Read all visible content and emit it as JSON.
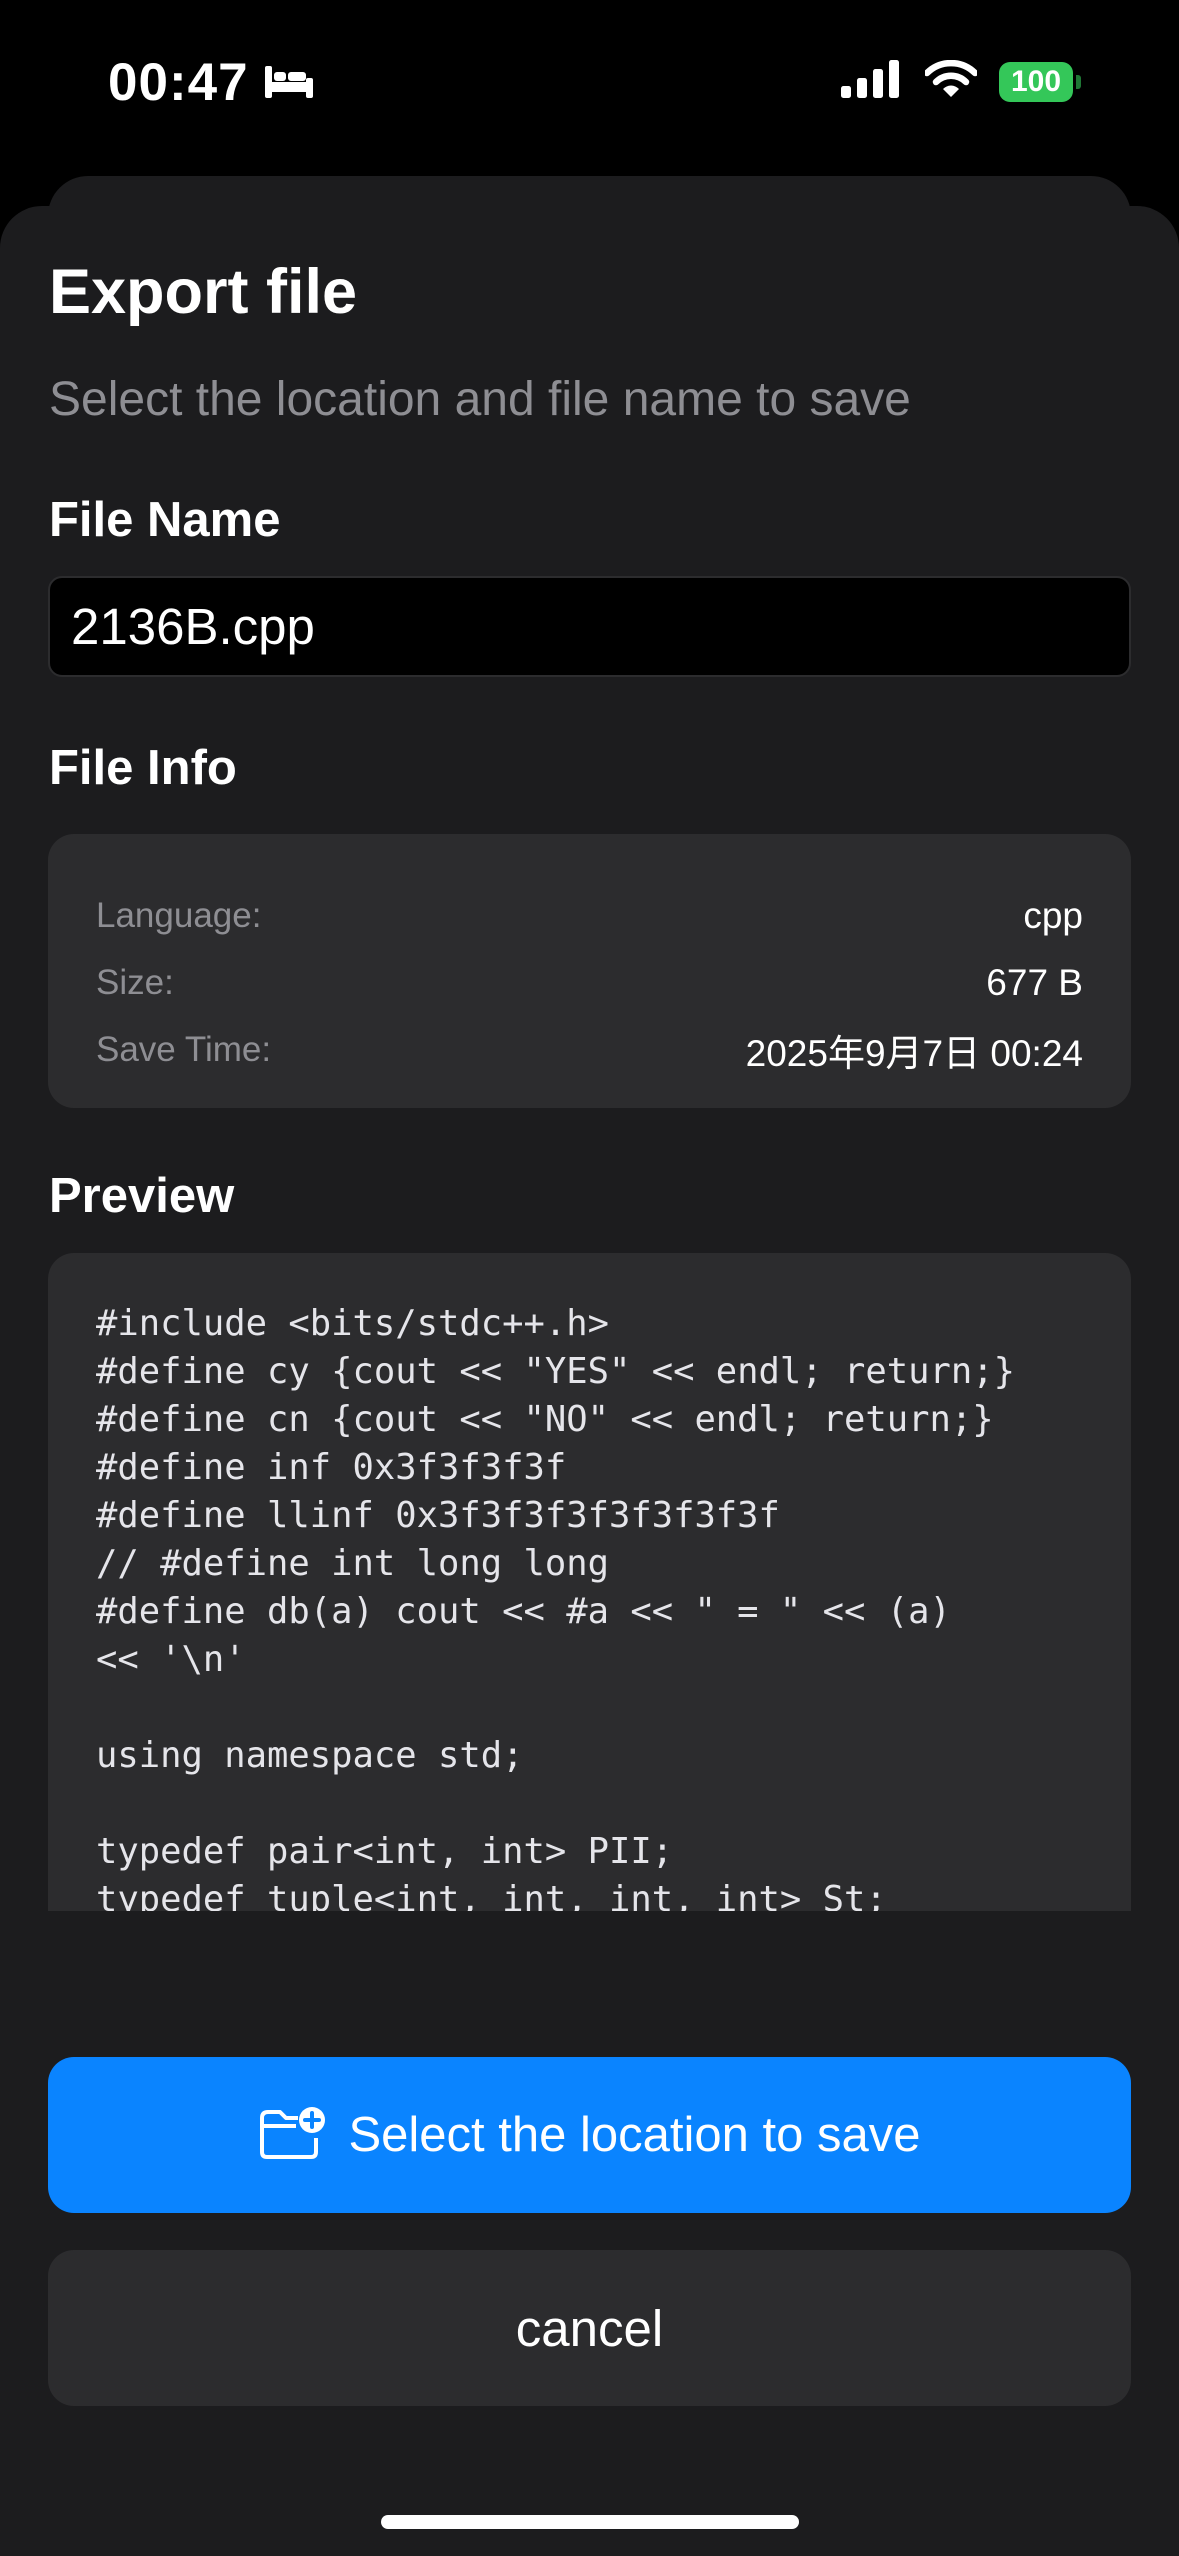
{
  "status_bar": {
    "time": "00:47",
    "focus_icon": "bed-icon",
    "battery": "100"
  },
  "sheet": {
    "title": "Export file",
    "subtitle": "Select the location and file name to save"
  },
  "file_name": {
    "label": "File Name",
    "value": "2136B.cpp"
  },
  "file_info": {
    "label": "File Info",
    "rows": [
      {
        "key": "Language:",
        "value": "cpp"
      },
      {
        "key": "Size:",
        "value": "677 B"
      },
      {
        "key": "Save Time:",
        "value": "2025年9月7日 00:24"
      }
    ]
  },
  "preview": {
    "label": "Preview",
    "lines": [
      "#include <bits/stdc++.h>",
      "#define cy {cout << \"YES\" << endl; return;}",
      "#define cn {cout << \"NO\" << endl; return;}",
      "#define inf 0x3f3f3f3f",
      "#define llinf 0x3f3f3f3f3f3f3f3f",
      "// #define int long long",
      "#define db(a) cout << #a << \" = \" << (a)",
      "<< '\\n'",
      "",
      "using namespace std;",
      "",
      "typedef pair<int, int> PII;",
      "typedef tuple<int, int, int, int> St;"
    ]
  },
  "actions": {
    "primary_label": "Select the location to save",
    "primary_icon": "folder-badge-plus-icon",
    "cancel_label": "cancel"
  },
  "colors": {
    "accent": "#0a84ff",
    "battery": "#34c759",
    "sheet_bg": "#1c1c1e",
    "card_bg": "#2c2c2e",
    "secondary_text": "#8e8e93"
  }
}
